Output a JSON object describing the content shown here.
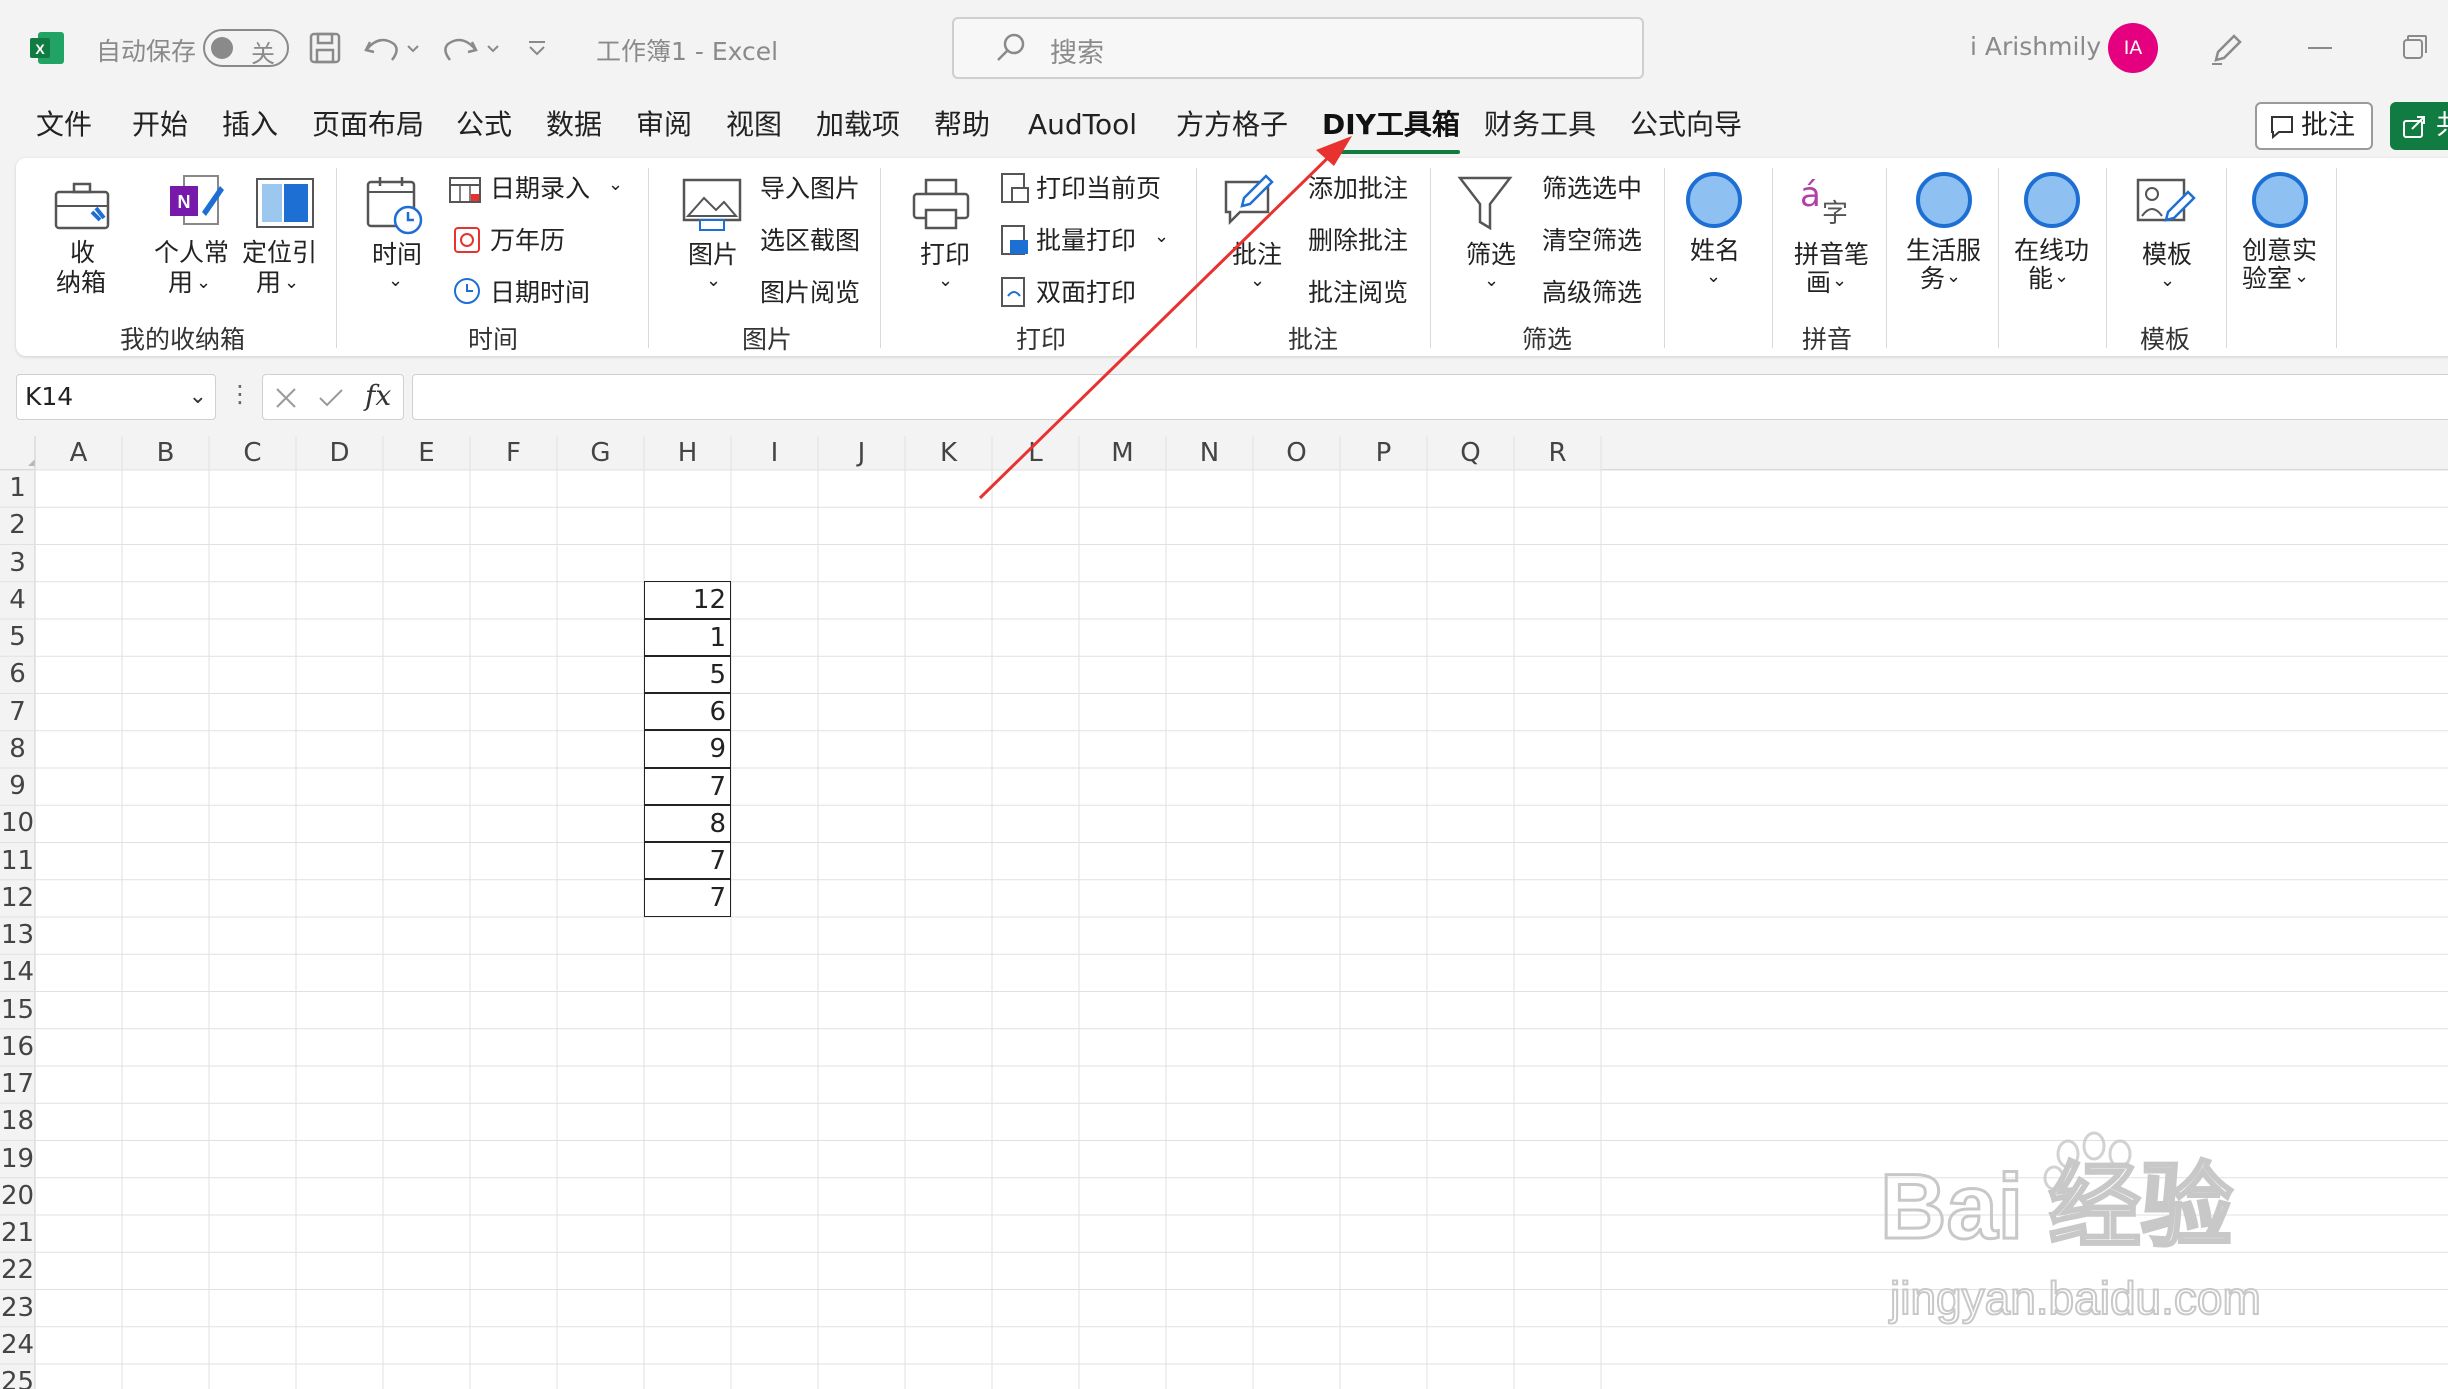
{
  "titlebar": {
    "autosave_label": "自动保存",
    "autosave_state": "关",
    "doc_title": "工作簿1  -  Excel",
    "search_placeholder": "搜索",
    "user_name": "i Arishmily",
    "avatar_initials": "IA"
  },
  "tabs": [
    {
      "label": "文件"
    },
    {
      "label": "开始"
    },
    {
      "label": "插入"
    },
    {
      "label": "页面布局"
    },
    {
      "label": "公式"
    },
    {
      "label": "数据"
    },
    {
      "label": "审阅"
    },
    {
      "label": "视图"
    },
    {
      "label": "加载项"
    },
    {
      "label": "帮助"
    },
    {
      "label": "AudTool"
    },
    {
      "label": "方方格子"
    },
    {
      "label": "DIY工具箱",
      "active": true
    },
    {
      "label": "财务工具"
    },
    {
      "label": "公式向导"
    }
  ],
  "actions": {
    "comment_label": "批注",
    "share_label": "共"
  },
  "ribbon": {
    "box": {
      "btn1": "收",
      "btn2": "纳箱",
      "personal1": "个人常",
      "personal2": "用",
      "locate1": "定位引",
      "locate2": "用",
      "group": "我的收纳箱"
    },
    "time": {
      "btn": "时间",
      "date_entry": "日期录入",
      "calendar": "万年历",
      "date_time": "日期时间",
      "group": "时间"
    },
    "picture": {
      "btn": "图片",
      "import": "导入图片",
      "screenshot": "选区截图",
      "browse": "图片阅览",
      "group": "图片"
    },
    "print": {
      "btn": "打印",
      "current": "打印当前页",
      "batch": "批量打印",
      "duplex": "双面打印",
      "group": "打印"
    },
    "comment": {
      "btn": "批注",
      "add": "添加批注",
      "delete": "删除批注",
      "browse": "批注阅览",
      "group": "批注"
    },
    "filter": {
      "btn": "筛选",
      "select": "筛选选中",
      "clear": "清空筛选",
      "advanced": "高级筛选",
      "group": "筛选"
    },
    "name": {
      "btn": "姓名"
    },
    "pinyin": {
      "btn1": "拼音笔",
      "btn2": "画",
      "group": "拼音"
    },
    "life": {
      "btn1": "生活服",
      "btn2": "务"
    },
    "online": {
      "btn1": "在线功",
      "btn2": "能"
    },
    "template": {
      "btn": "模板",
      "group": "模板"
    },
    "lab": {
      "btn1": "创意实",
      "btn2": "验室"
    }
  },
  "formula_bar": {
    "cell_ref": "K14",
    "fx": "fx",
    "content": ""
  },
  "sheet": {
    "columns": [
      "A",
      "B",
      "C",
      "D",
      "E",
      "F",
      "G",
      "H",
      "I",
      "J",
      "K",
      "L",
      "M",
      "N",
      "O",
      "P",
      "Q",
      "R"
    ],
    "rows": [
      "1",
      "2",
      "3",
      "4",
      "5",
      "6",
      "7",
      "8",
      "9",
      "10",
      "11",
      "12",
      "13",
      "14",
      "15",
      "16",
      "17",
      "18",
      "19",
      "20",
      "21",
      "22",
      "23",
      "24",
      "25"
    ],
    "cells": [
      {
        "ref": "H4",
        "value": "12"
      },
      {
        "ref": "H5",
        "value": "1"
      },
      {
        "ref": "H6",
        "value": "5"
      },
      {
        "ref": "H7",
        "value": "6"
      },
      {
        "ref": "H8",
        "value": "9"
      },
      {
        "ref": "H9",
        "value": "7"
      },
      {
        "ref": "H10",
        "value": "8"
      },
      {
        "ref": "H11",
        "value": "7"
      },
      {
        "ref": "H12",
        "value": "7"
      }
    ]
  },
  "watermark": {
    "brand": "Bai 经验",
    "url": "jingyan.baidu.com"
  },
  "colors": {
    "excel_green": "#107c41",
    "annotation_arrow": "#e8322f",
    "avatar": "#e4007e",
    "circle_icon": "#1e6fd4"
  }
}
